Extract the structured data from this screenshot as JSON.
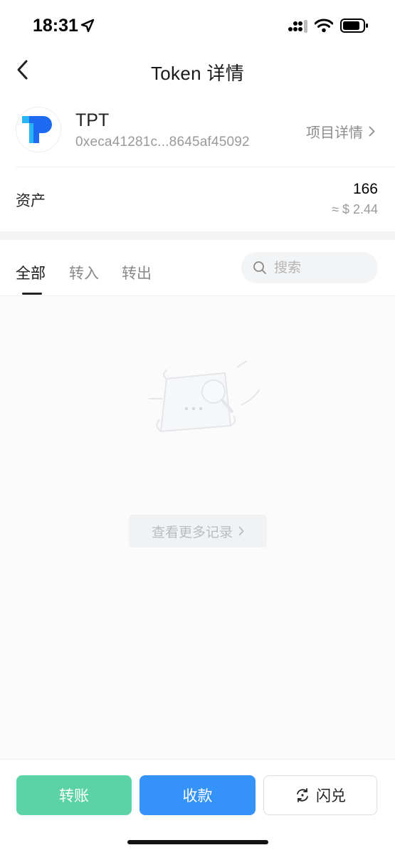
{
  "status_bar": {
    "time": "18:31",
    "icons": [
      "location-arrow-icon",
      "cellular-signal-icon",
      "wifi-icon",
      "battery-icon"
    ]
  },
  "header": {
    "title": "Token 详情",
    "back_icon": "chevron-left-icon"
  },
  "token": {
    "name": "TPT",
    "address": "0xeca41281c...8645af45092",
    "project_link": "项目详情",
    "logo_icon": "tpt-logo",
    "brand_colors": [
      "#1e6bf2",
      "#29b6f6"
    ]
  },
  "asset": {
    "label": "资产",
    "amount": "166",
    "value": "≈ $ 2.44"
  },
  "tabs": [
    {
      "label": "全部",
      "active": true
    },
    {
      "label": "转入",
      "active": false
    },
    {
      "label": "转出",
      "active": false
    }
  ],
  "search": {
    "placeholder": "搜索",
    "value": ""
  },
  "records": {
    "more_label": "查看更多记录",
    "empty_icon": "empty-records-illustration"
  },
  "actions": {
    "transfer": "转账",
    "receive": "收款",
    "swap": "闪兑"
  },
  "colors": {
    "transfer_button": "#5bd3a6",
    "receive_button": "#3592f8"
  }
}
